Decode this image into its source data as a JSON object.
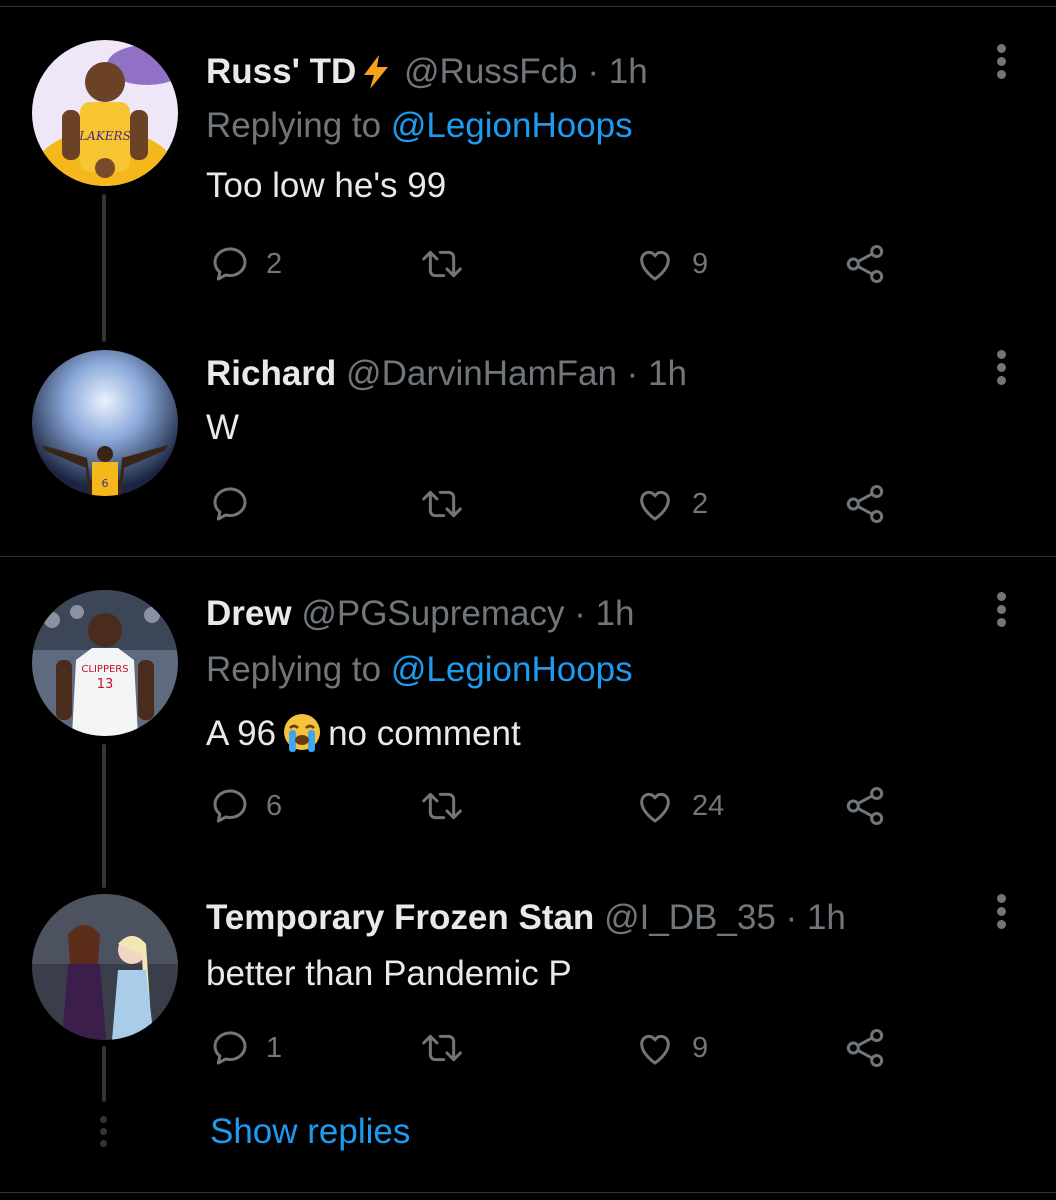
{
  "tweets": [
    {
      "display_name": "Russ' TD",
      "handle": "@RussFcb",
      "separator": "·",
      "time": "1h",
      "replying_prefix": "Replying to",
      "replying_to": "@LegionHoops",
      "text": "Too low he's 99",
      "replies": "2",
      "retweets": "",
      "likes": "9",
      "badge_icon": "lightning-bolt-icon",
      "avatar_subject": "Lakers player"
    },
    {
      "display_name": "Richard",
      "handle": "@DarvinHamFan",
      "separator": "·",
      "time": "1h",
      "text": "W",
      "replies": "",
      "retweets": "",
      "likes": "2",
      "avatar_subject": "Player number 6 with arms raised"
    },
    {
      "display_name": "Drew",
      "handle": "@PGSupremacy",
      "separator": "·",
      "time": "1h",
      "replying_prefix": "Replying to",
      "replying_to": "@LegionHoops",
      "text_before": "A 96",
      "text_emoji": "loudly-crying-face-emoji",
      "text_after": "no comment",
      "replies": "6",
      "retweets": "",
      "likes": "24",
      "avatar_subject": "Clippers player number 13"
    },
    {
      "display_name": "Temporary Frozen Stan",
      "handle": "@I_DB_35",
      "separator": "·",
      "time": "1h",
      "text": "better than Pandemic P",
      "replies": "1",
      "retweets": "",
      "likes": "9",
      "avatar_subject": "Anna and Elsa"
    }
  ],
  "show_replies_label": "Show replies",
  "colors": {
    "background": "#000000",
    "primary_text": "#e7e9ea",
    "secondary_text": "#71767b",
    "link": "#1d9bf0",
    "divider": "#2f3336",
    "thread_line": "#333639",
    "bolt": "#f7a21b"
  }
}
